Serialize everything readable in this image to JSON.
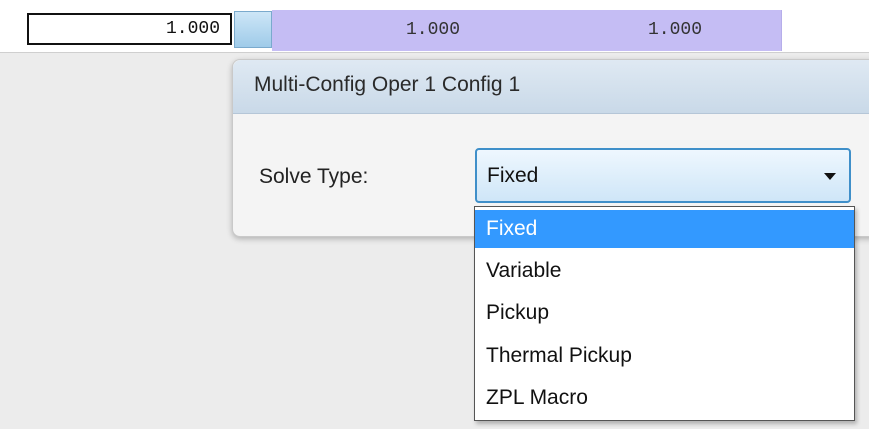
{
  "grid": {
    "cells": [
      "1.000",
      "1.000",
      "1.000"
    ]
  },
  "popup": {
    "title": "Multi-Config Oper 1 Config 1",
    "solve_type_label": "Solve Type:",
    "solve_type_value": "Fixed"
  },
  "dropdown": {
    "options": [
      "Fixed",
      "Variable",
      "Pickup",
      "Thermal Pickup",
      "ZPL Macro"
    ],
    "selected": "Fixed"
  },
  "colors": {
    "accent": "#3399ff",
    "cell_highlight": "#c5bdf4",
    "header_bg": "#c9d9e8"
  }
}
